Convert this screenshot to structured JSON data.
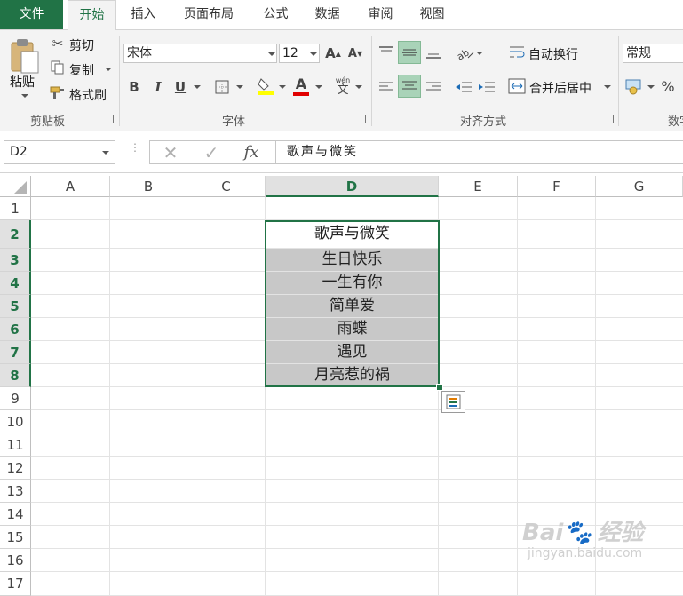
{
  "tabs": {
    "file": "文件",
    "items": [
      "开始",
      "插入",
      "页面布局",
      "公式",
      "数据",
      "审阅",
      "视图"
    ]
  },
  "ribbon": {
    "clipboard": {
      "paste": "粘贴",
      "cut": "剪切",
      "copy": "复制",
      "format_painter": "格式刷",
      "label": "剪贴板"
    },
    "font": {
      "name": "宋体",
      "size": "12",
      "bold": "B",
      "italic": "I",
      "underline": "U",
      "grow": "A",
      "shrink": "A",
      "font_color": "A",
      "phonetic": "wén",
      "phonetic_char": "文",
      "label": "字体"
    },
    "alignment": {
      "wrap_text": "自动换行",
      "merge_center": "合并后居中",
      "label": "对齐方式"
    },
    "number": {
      "format": "常规",
      "percent": "%",
      "label": "数字"
    }
  },
  "formula_bar": {
    "name_box": "D2",
    "fx": "fx",
    "content": "歌声与微笑"
  },
  "sheet": {
    "columns": [
      "A",
      "B",
      "C",
      "D",
      "E",
      "F",
      "G"
    ],
    "selected_column": "D",
    "rows": [
      "1",
      "2",
      "3",
      "4",
      "5",
      "6",
      "7",
      "8",
      "9",
      "10",
      "11",
      "12",
      "13",
      "14",
      "15",
      "16",
      "17"
    ],
    "selected_rows": [
      "2",
      "3",
      "4",
      "5",
      "6",
      "7",
      "8"
    ],
    "cells_D": [
      "歌声与微笑",
      "生日快乐",
      "一生有你",
      "简单爱",
      "雨蝶",
      "遇见",
      "月亮惹的祸"
    ],
    "fill_color": "#c8c8c8",
    "accent": "#217346"
  },
  "watermark": {
    "brand": "Bai",
    "brand2": "经验",
    "url": "jingyan.baidu.com"
  }
}
